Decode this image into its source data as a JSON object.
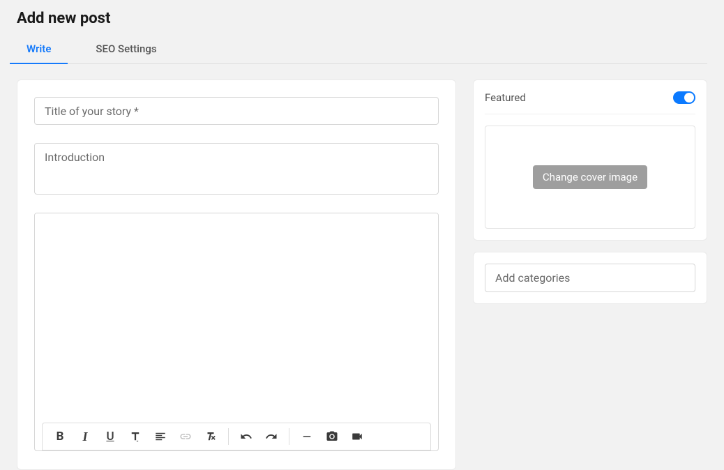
{
  "page": {
    "title": "Add new post"
  },
  "tabs": {
    "write": "Write",
    "seo": "SEO Settings"
  },
  "form": {
    "title_placeholder": "Title of your story *",
    "intro_placeholder": "Introduction"
  },
  "toolbar": {
    "bold": "B",
    "italic": "I",
    "underline": "U"
  },
  "sidebar": {
    "featured_label": "Featured",
    "cover_button": "Change cover image",
    "categories_placeholder": "Add categories"
  }
}
